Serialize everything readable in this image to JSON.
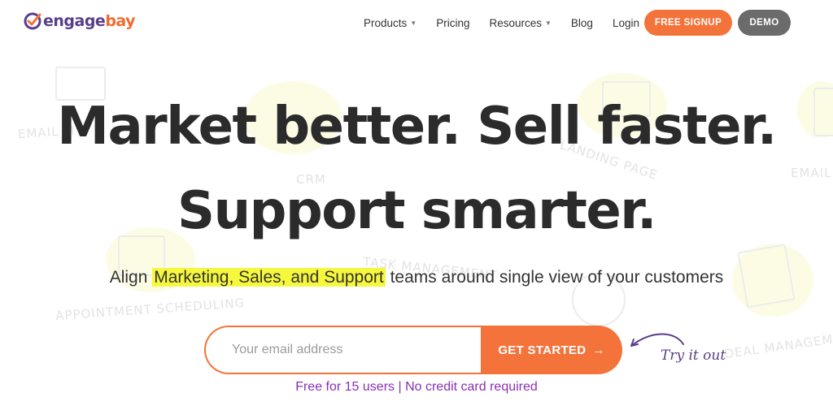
{
  "brand": {
    "name_part1": "engage",
    "name_part2": "bay",
    "primary_color": "#f4733a",
    "secondary_color": "#5a3d8a"
  },
  "nav": {
    "items": [
      {
        "label": "Products",
        "has_dropdown": true
      },
      {
        "label": "Pricing",
        "has_dropdown": false
      },
      {
        "label": "Resources",
        "has_dropdown": true
      },
      {
        "label": "Blog",
        "has_dropdown": false
      },
      {
        "label": "Login",
        "has_dropdown": false
      }
    ],
    "signup_label": "FREE SIGNUP",
    "demo_label": "DEMO"
  },
  "hero": {
    "headline_line1": "Market better. Sell faster.",
    "headline_line2": "Support smarter.",
    "sub_prefix": "Align ",
    "sub_highlight": "Marketing, Sales, and Support",
    "sub_suffix": " teams around single view of your customers",
    "email_placeholder": "Your email address",
    "cta_label": "GET STARTED",
    "cta_icon": "arrow-right-icon",
    "try_it_label": "Try it out",
    "note": "Free for 15 users | No credit card required"
  },
  "background_labels": {
    "email_left": "EMAIL M",
    "crm": "CRM",
    "landing_page": "LANDING PAGE",
    "email_right": "EMAIL",
    "task": "TASK MANAGEMENT",
    "appointment": "APPOINTMENT SCHEDULING",
    "deal": "DEAL MANAGEM"
  }
}
